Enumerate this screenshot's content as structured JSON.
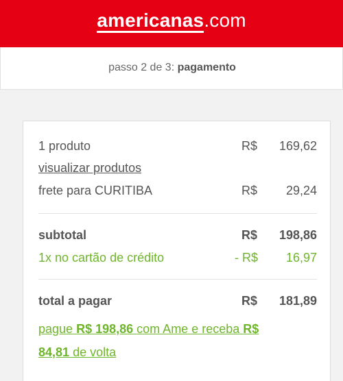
{
  "header": {
    "brand": "americanas",
    "tld": ".com",
    "bg_color": "#e60014"
  },
  "step": {
    "prefix": "passo 2 de 3:",
    "name": "pagamento"
  },
  "summary": {
    "products": {
      "label": "1 produto",
      "currency": "R$",
      "amount": "169,62"
    },
    "view_products_link": "visualizar produtos",
    "shipping": {
      "label": "frete para CURITIBA",
      "currency": "R$",
      "amount": "29,24"
    },
    "subtotal": {
      "label": "subtotal",
      "currency": "R$",
      "amount": "198,86"
    },
    "discount": {
      "label": "1x no cartão de crédito",
      "currency": "- R$",
      "amount": "16,97"
    },
    "total": {
      "label": "total a pagar",
      "currency": "R$",
      "amount": "181,89"
    },
    "promo": {
      "text1": "pague",
      "amount1": "R$ 198,86",
      "text2": "com Ame e receba",
      "amount2_currency": "R$",
      "amount2_value": "84,81",
      "text3": "de volta"
    },
    "accent_color": "#6fb52c"
  }
}
